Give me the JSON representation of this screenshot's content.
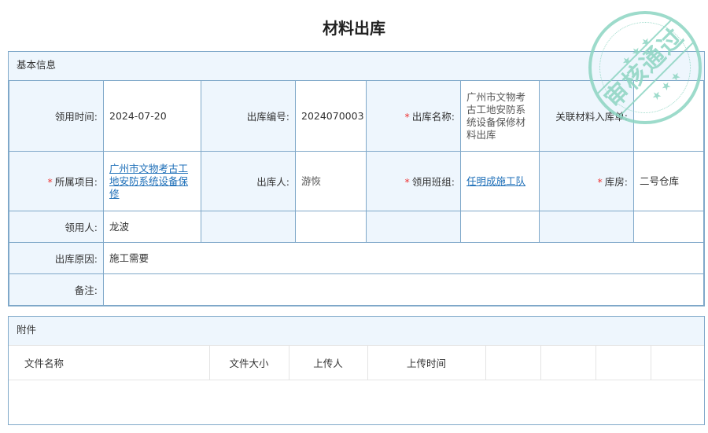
{
  "title": "材料出库",
  "basic": {
    "header": "基本信息",
    "fields": {
      "use_time": {
        "label": "领用时间:",
        "value": "2024-07-20"
      },
      "out_no": {
        "label": "出库编号:",
        "value": "2024070003"
      },
      "out_name": {
        "label": "出库名称:",
        "value": "广州市文物考古工地安防系统设备保修材料出库",
        "required": true
      },
      "related_in": {
        "label": "关联材料入库单:",
        "value": ""
      },
      "project": {
        "label": "所属项目:",
        "value": "广州市文物考古工地安防系统设备保修",
        "required": true
      },
      "out_person": {
        "label": "出库人:",
        "value": "游恢"
      },
      "team": {
        "label": "领用班组:",
        "value": "任明成施工队",
        "required": true
      },
      "warehouse": {
        "label": "库房:",
        "value": "二号仓库",
        "required": true
      },
      "receiver": {
        "label": "领用人:",
        "value": "龙波"
      },
      "reason": {
        "label": "出库原因:",
        "value": "施工需要"
      },
      "remark": {
        "label": "备注:",
        "value": ""
      }
    },
    "required_mark": "*"
  },
  "attachments": {
    "header": "附件",
    "columns": [
      "文件名称",
      "文件大小",
      "上传人",
      "上传时间"
    ],
    "rows": []
  },
  "stamp": {
    "text": "审核通过",
    "color": "#8dd5c2"
  }
}
